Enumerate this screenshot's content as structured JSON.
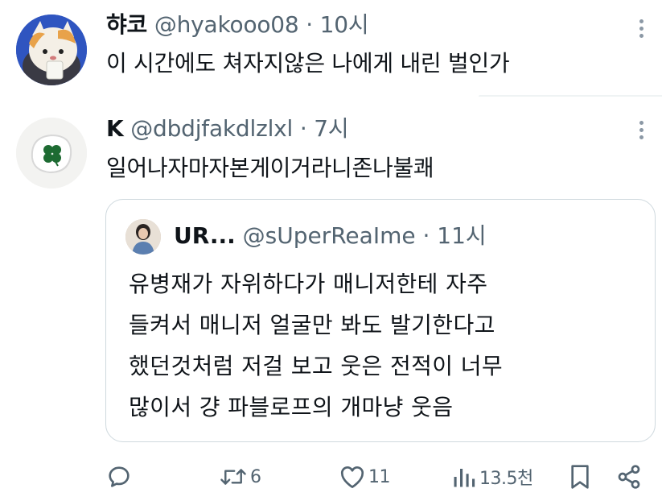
{
  "tweets": [
    {
      "name": "햐코",
      "handle": "@hyakooo08",
      "separator": "·",
      "time": "10시",
      "text": "이 시간에도 쳐자지않은 나에게 내린 벌인가"
    },
    {
      "name": "K",
      "handle": "@dbdjfakdlzlxl",
      "separator": "·",
      "time": "7시",
      "text": "일어나자마자본게이거라니존나불쾌",
      "quote": {
        "name": "UR...",
        "handle": "@sUperReaIme",
        "separator": "·",
        "time": "11시",
        "lines": [
          "유병재가 자위하다가 매니저한테 자주",
          "들켜서 매니저 얼굴만 봐도 발기한다고",
          "했던것처럼 저걸 보고 웃은 전적이 너무",
          "많이서 걍 파블로프의 개마냥 웃음"
        ]
      },
      "actions": {
        "reply_icon": "reply-icon",
        "retweet_icon": "retweet-icon",
        "retweet_count": "6",
        "like_icon": "heart-icon",
        "like_count": "11",
        "views_icon": "views-icon",
        "views_count": "13.5천",
        "bookmark_icon": "bookmark-icon",
        "share_icon": "share-icon"
      }
    }
  ],
  "colors": {
    "text_primary": "#0f1419",
    "text_secondary": "#536471",
    "border": "#cfd9de",
    "more_dots": "#8b98a5"
  }
}
